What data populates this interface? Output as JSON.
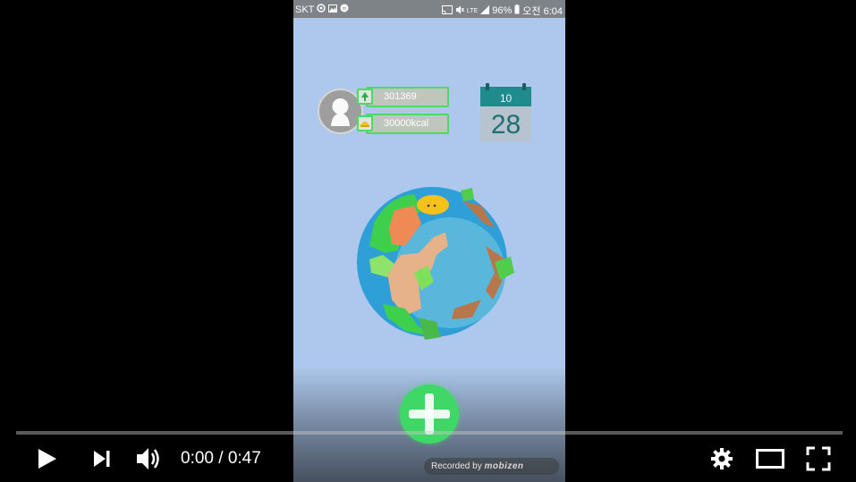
{
  "status_bar": {
    "carrier": "SKT",
    "lte": "LTE",
    "battery": "96%",
    "time": "오전 6:04"
  },
  "app": {
    "stat_steps": "301369",
    "stat_kcal": "30000kcal",
    "calendar": {
      "month": "10",
      "day": "28"
    },
    "recorded_by": "Recorded by",
    "recorder_brand": "mobizen"
  },
  "player": {
    "time_current": "0:00",
    "time_separator": " / ",
    "time_total": "0:47",
    "progress": 0
  },
  "colors": {
    "phone_background": "#adc8ec",
    "accent_green": "#4cd964",
    "calendar_teal": "#1f8b8d"
  }
}
